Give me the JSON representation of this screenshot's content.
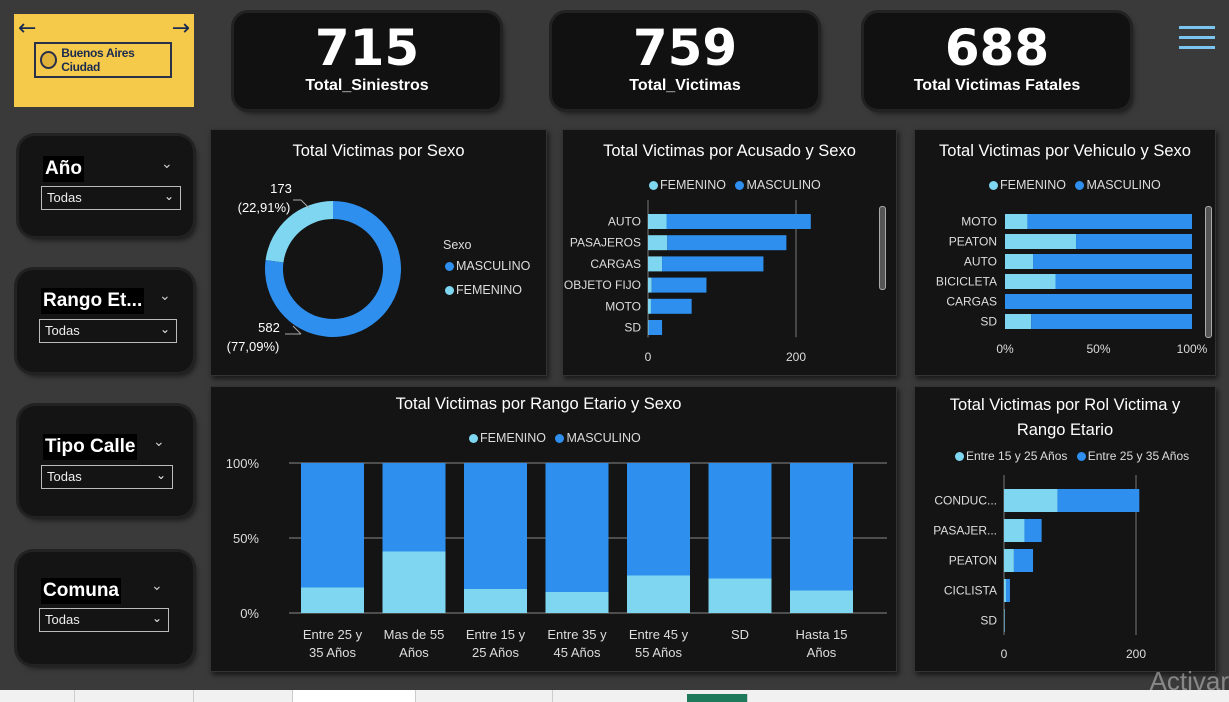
{
  "logo": {
    "back": "←",
    "forward": "→",
    "text": "Buenos Aires Ciudad"
  },
  "kpis": [
    {
      "value": "715",
      "label": "Total_Siniestros"
    },
    {
      "value": "759",
      "label": "Total_Victimas"
    },
    {
      "value": "688",
      "label": "Total Victimas Fatales"
    }
  ],
  "slicers": [
    {
      "title": "Año",
      "value": "Todas"
    },
    {
      "title": "Rango Et...",
      "value": "Todas"
    },
    {
      "title": "Tipo Calle",
      "value": "Todas"
    },
    {
      "title": "Comuna",
      "value": "Todas"
    }
  ],
  "colors": {
    "femenino": "#7fd6f0",
    "masculino": "#2f8fef",
    "background": "#3a3a3a",
    "panel": "#141414"
  },
  "chart_data": [
    {
      "type": "pie",
      "title": "Total Victimas por Sexo",
      "legend_title": "Sexo",
      "slices": [
        {
          "name": "MASCULINO",
          "value": 582,
          "label": "582",
          "pct": "(77,09%)"
        },
        {
          "name": "FEMENINO",
          "value": 173,
          "label": "173",
          "pct": "(22,91%)"
        }
      ]
    },
    {
      "type": "bar",
      "title": "Total Victimas por Acusado y Sexo",
      "categories": [
        "AUTO",
        "PASAJEROS",
        "CARGAS",
        "OBJETO FIJO",
        "MOTO",
        "SD"
      ],
      "series": [
        {
          "name": "FEMENINO",
          "values": [
            25,
            26,
            19,
            5,
            4,
            1
          ]
        },
        {
          "name": "MASCULINO",
          "values": [
            195,
            161,
            137,
            74,
            55,
            18
          ]
        }
      ],
      "xlim": [
        0,
        230
      ],
      "xticks": [
        "0",
        "200"
      ]
    },
    {
      "type": "bar",
      "title": "Total Victimas por Vehiculo y Sexo",
      "categories": [
        "MOTO",
        "PEATON",
        "AUTO",
        "BICICLETA",
        "CARGAS",
        "SD"
      ],
      "series": [
        {
          "name": "FEMENINO",
          "values": [
            12,
            38,
            15,
            27,
            0,
            14
          ]
        },
        {
          "name": "MASCULINO",
          "values": [
            88,
            62,
            85,
            73,
            100,
            86
          ]
        }
      ],
      "xticks": [
        "0%",
        "50%",
        "100%"
      ]
    },
    {
      "type": "bar",
      "title": "Total Victimas por Rango Etario y Sexo",
      "categories": [
        "Entre 25 y 35 Años",
        "Mas de 55 Años",
        "Entre 15 y 25 Años",
        "Entre 35 y 45 Años",
        "Entre 45 y 55 Años",
        "SD",
        "Hasta 15 Años"
      ],
      "series": [
        {
          "name": "FEMENINO",
          "values": [
            17,
            41,
            16,
            14,
            25,
            23,
            15
          ]
        },
        {
          "name": "MASCULINO",
          "values": [
            83,
            59,
            84,
            86,
            75,
            77,
            85
          ]
        }
      ],
      "yticks": [
        "100%",
        "50%",
        "0%"
      ]
    },
    {
      "type": "bar",
      "title": "Total Victimas por Rol Victima y Rango Etario",
      "categories": [
        "CONDUC...",
        "PASAJER...",
        "PEATON",
        "CICLISTA",
        "SD"
      ],
      "series": [
        {
          "name": "Entre 15 y 25 Años",
          "values": [
            81,
            31,
            15,
            3,
            1
          ]
        },
        {
          "name": "Entre 25 y 35 Años",
          "values": [
            124,
            26,
            29,
            6,
            0
          ]
        }
      ],
      "xlim": [
        0,
        230
      ],
      "xticks": [
        "0",
        "200"
      ]
    }
  ],
  "watermark": "Activar"
}
